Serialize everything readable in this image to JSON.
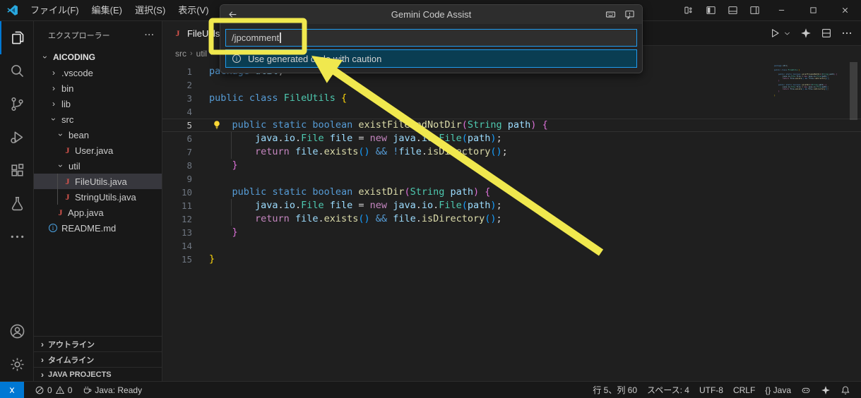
{
  "colors": {
    "accent": "#0078d4",
    "focus_border": "#1f9cf0",
    "annotation_yellow": "#f0e84e",
    "selected_row": "#37373d",
    "list_focus_teal": "#0a3d52"
  },
  "token_colors": {
    "kw": "#569cd6",
    "ctrl": "#c586c0",
    "type": "#4ec9b0",
    "fn": "#dcdcaa",
    "var": "#9cdcfe",
    "pl": "#d4d4d4",
    "b1": "#ffd70b",
    "b2": "#da70d6",
    "b3": "#179fff"
  },
  "title_bar": {
    "menus": [
      "ファイル(F)",
      "編集(E)",
      "選択(S)",
      "表示(V)",
      "···"
    ],
    "layout_icons": [
      "customize-layout",
      "toggle-primary-sidebar",
      "toggle-panel",
      "toggle-secondary-sidebar"
    ],
    "window_controls": [
      "minimize",
      "maximize",
      "close"
    ]
  },
  "quick_input": {
    "title": "Gemini Code Assist",
    "back_icon": "back",
    "header_icons": [
      "keyboard",
      "feedback"
    ],
    "input_value": "/jpcomment",
    "list": [
      {
        "icon": "info",
        "label": "Use generated code with caution",
        "selected": true
      }
    ]
  },
  "activity_bar": {
    "top": [
      "files",
      "search",
      "source-control",
      "debug",
      "extensions",
      "testing",
      "more"
    ],
    "bottom": [
      "account",
      "settings"
    ]
  },
  "sidebar": {
    "header": "エクスプローラー",
    "header_more": "···",
    "tree": [
      {
        "label": "AICODING",
        "level": 0,
        "kind": "root",
        "expanded": true
      },
      {
        "label": ".vscode",
        "level": 1,
        "kind": "folder",
        "expanded": false
      },
      {
        "label": "bin",
        "level": 1,
        "kind": "folder",
        "expanded": false
      },
      {
        "label": "lib",
        "level": 1,
        "kind": "folder",
        "expanded": false
      },
      {
        "label": "src",
        "level": 1,
        "kind": "folder",
        "expanded": true
      },
      {
        "label": "bean",
        "level": 2,
        "kind": "folder",
        "expanded": true
      },
      {
        "label": "User.java",
        "level": 3,
        "kind": "java"
      },
      {
        "label": "util",
        "level": 2,
        "kind": "folder",
        "expanded": true
      },
      {
        "label": "FileUtils.java",
        "level": 3,
        "kind": "java",
        "selected": true
      },
      {
        "label": "StringUtils.java",
        "level": 3,
        "kind": "java"
      },
      {
        "label": "App.java",
        "level": 2,
        "kind": "java"
      },
      {
        "label": "README.md",
        "level": 1,
        "kind": "info"
      }
    ],
    "sections": [
      "アウトライン",
      "タイムライン",
      "JAVA PROJECTS"
    ]
  },
  "editor": {
    "tab": {
      "icon": "java",
      "label": "FileUtils.java"
    },
    "breadcrumb": [
      "src",
      "util"
    ],
    "actions": [
      "run",
      "chevron-down",
      "sparkle",
      "split-editor",
      "more-h"
    ],
    "current_line": 5,
    "lightbulb_line": 5,
    "lines": [
      {
        "n": 1,
        "tokens": [
          [
            "kw",
            "package"
          ],
          [
            "pl",
            " "
          ],
          [
            "var",
            "util"
          ],
          [
            "pl",
            ";"
          ]
        ]
      },
      {
        "n": 2,
        "tokens": []
      },
      {
        "n": 3,
        "tokens": [
          [
            "kw",
            "public"
          ],
          [
            "pl",
            " "
          ],
          [
            "kw",
            "class"
          ],
          [
            "pl",
            " "
          ],
          [
            "type",
            "FileUtils"
          ],
          [
            "pl",
            " "
          ],
          [
            "b1",
            "{"
          ]
        ]
      },
      {
        "n": 4,
        "tokens": []
      },
      {
        "n": 5,
        "tokens": [
          [
            "pl",
            "    "
          ],
          [
            "kw",
            "public"
          ],
          [
            "pl",
            " "
          ],
          [
            "kw",
            "static"
          ],
          [
            "pl",
            " "
          ],
          [
            "kw",
            "boolean"
          ],
          [
            "pl",
            " "
          ],
          [
            "fn",
            "existFileAndNotDir"
          ],
          [
            "b2",
            "("
          ],
          [
            "type",
            "String"
          ],
          [
            "pl",
            " "
          ],
          [
            "var",
            "path"
          ],
          [
            "b2",
            ")"
          ],
          [
            "pl",
            " "
          ],
          [
            "b2",
            "{"
          ]
        ]
      },
      {
        "n": 6,
        "tokens": [
          [
            "pl",
            "        "
          ],
          [
            "var",
            "java"
          ],
          [
            "pl",
            "."
          ],
          [
            "var",
            "io"
          ],
          [
            "pl",
            "."
          ],
          [
            "type",
            "File"
          ],
          [
            "pl",
            " "
          ],
          [
            "var",
            "file"
          ],
          [
            "pl",
            " = "
          ],
          [
            "ctrl",
            "new"
          ],
          [
            "pl",
            " "
          ],
          [
            "var",
            "java"
          ],
          [
            "pl",
            "."
          ],
          [
            "var",
            "io"
          ],
          [
            "pl",
            "."
          ],
          [
            "type",
            "File"
          ],
          [
            "b3",
            "("
          ],
          [
            "var",
            "path"
          ],
          [
            "b3",
            ")"
          ],
          [
            "pl",
            ";"
          ]
        ]
      },
      {
        "n": 7,
        "tokens": [
          [
            "pl",
            "        "
          ],
          [
            "ctrl",
            "return"
          ],
          [
            "pl",
            " "
          ],
          [
            "var",
            "file"
          ],
          [
            "pl",
            "."
          ],
          [
            "fn",
            "exists"
          ],
          [
            "b3",
            "()"
          ],
          [
            "pl",
            " "
          ],
          [
            "kw",
            "&&"
          ],
          [
            "pl",
            " "
          ],
          [
            "kw",
            "!"
          ],
          [
            "var",
            "file"
          ],
          [
            "pl",
            "."
          ],
          [
            "fn",
            "isDirectory"
          ],
          [
            "b3",
            "()"
          ],
          [
            "pl",
            ";"
          ]
        ]
      },
      {
        "n": 8,
        "tokens": [
          [
            "pl",
            "    "
          ],
          [
            "b2",
            "}"
          ]
        ]
      },
      {
        "n": 9,
        "tokens": []
      },
      {
        "n": 10,
        "tokens": [
          [
            "pl",
            "    "
          ],
          [
            "kw",
            "public"
          ],
          [
            "pl",
            " "
          ],
          [
            "kw",
            "static"
          ],
          [
            "pl",
            " "
          ],
          [
            "kw",
            "boolean"
          ],
          [
            "pl",
            " "
          ],
          [
            "fn",
            "existDir"
          ],
          [
            "b2",
            "("
          ],
          [
            "type",
            "String"
          ],
          [
            "pl",
            " "
          ],
          [
            "var",
            "path"
          ],
          [
            "b2",
            ")"
          ],
          [
            "pl",
            " "
          ],
          [
            "b2",
            "{"
          ]
        ]
      },
      {
        "n": 11,
        "tokens": [
          [
            "pl",
            "        "
          ],
          [
            "var",
            "java"
          ],
          [
            "pl",
            "."
          ],
          [
            "var",
            "io"
          ],
          [
            "pl",
            "."
          ],
          [
            "type",
            "File"
          ],
          [
            "pl",
            " "
          ],
          [
            "var",
            "file"
          ],
          [
            "pl",
            " = "
          ],
          [
            "ctrl",
            "new"
          ],
          [
            "pl",
            " "
          ],
          [
            "var",
            "java"
          ],
          [
            "pl",
            "."
          ],
          [
            "var",
            "io"
          ],
          [
            "pl",
            "."
          ],
          [
            "type",
            "File"
          ],
          [
            "b3",
            "("
          ],
          [
            "var",
            "path"
          ],
          [
            "b3",
            ")"
          ],
          [
            "pl",
            ";"
          ]
        ]
      },
      {
        "n": 12,
        "tokens": [
          [
            "pl",
            "        "
          ],
          [
            "ctrl",
            "return"
          ],
          [
            "pl",
            " "
          ],
          [
            "var",
            "file"
          ],
          [
            "pl",
            "."
          ],
          [
            "fn",
            "exists"
          ],
          [
            "b3",
            "()"
          ],
          [
            "pl",
            " "
          ],
          [
            "kw",
            "&&"
          ],
          [
            "pl",
            " "
          ],
          [
            "var",
            "file"
          ],
          [
            "pl",
            "."
          ],
          [
            "fn",
            "isDirectory"
          ],
          [
            "b3",
            "()"
          ],
          [
            "pl",
            ";"
          ]
        ]
      },
      {
        "n": 13,
        "tokens": [
          [
            "pl",
            "    "
          ],
          [
            "b2",
            "}"
          ]
        ]
      },
      {
        "n": 14,
        "tokens": []
      },
      {
        "n": 15,
        "tokens": [
          [
            "b1",
            "}"
          ]
        ]
      }
    ]
  },
  "status_bar": {
    "left": [
      {
        "icon": "remote",
        "label": "",
        "name": "remote-indicator"
      },
      {
        "icon": "error",
        "label": "0",
        "name": "errors"
      },
      {
        "icon": "warning",
        "label": "0",
        "name": "warnings"
      },
      {
        "icon": "coffee",
        "label": "Java: Ready",
        "name": "java-status"
      }
    ],
    "right": [
      {
        "label": "行 5、列 60",
        "name": "cursor-position"
      },
      {
        "label": "スペース: 4",
        "name": "indentation"
      },
      {
        "label": "UTF-8",
        "name": "encoding"
      },
      {
        "label": "CRLF",
        "name": "eol"
      },
      {
        "label": "{} Java",
        "name": "language-mode"
      },
      {
        "icon": "copilot",
        "label": "",
        "name": "copilot"
      },
      {
        "icon": "sparkle",
        "label": "",
        "name": "gemini"
      },
      {
        "icon": "bell",
        "label": "",
        "name": "notifications"
      }
    ]
  },
  "annotation": {
    "highlight_color": "#f0e84e",
    "shape": "rectangle-and-arrow",
    "target": "command-input"
  }
}
